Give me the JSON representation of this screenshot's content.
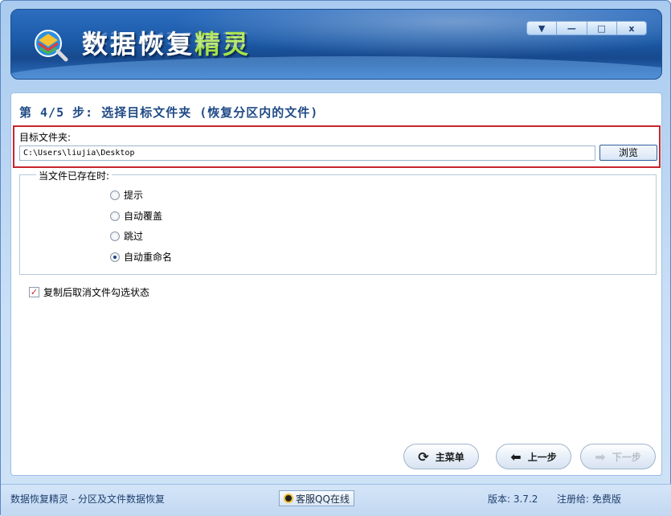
{
  "app": {
    "title_white": "数据恢复",
    "title_green": "精灵",
    "reflection": "数据恢复精灵"
  },
  "window_controls": {
    "menu": "▼",
    "minimize": "—",
    "maximize": "□",
    "close": "x"
  },
  "step": {
    "title": "第 4/5 步: 选择目标文件夹 (恢复分区内的文件)"
  },
  "target": {
    "label": "目标文件夹:",
    "path": "C:\\Users\\liujia\\Desktop",
    "browse_label": "浏览"
  },
  "exists_group": {
    "legend": "当文件已存在时:",
    "options": [
      {
        "label": "提示",
        "checked": false
      },
      {
        "label": "自动覆盖",
        "checked": false
      },
      {
        "label": "跳过",
        "checked": false
      },
      {
        "label": "自动重命名",
        "checked": true
      }
    ]
  },
  "uncheck_option": {
    "label": "复制后取消文件勾选状态",
    "checked": true
  },
  "nav": {
    "main_menu": "主菜单",
    "prev": "上一步",
    "next": "下一步"
  },
  "status": {
    "left": "数据恢复精灵 - 分区及文件数据恢复",
    "qq": "客服QQ在线",
    "version": "版本: 3.7.2",
    "registered": "注册给: 免费版"
  },
  "colors": {
    "banner": "#1b5aa8",
    "title_green": "#a6e24a",
    "highlight_border": "#c8252d",
    "step_title": "#1f4a86"
  }
}
